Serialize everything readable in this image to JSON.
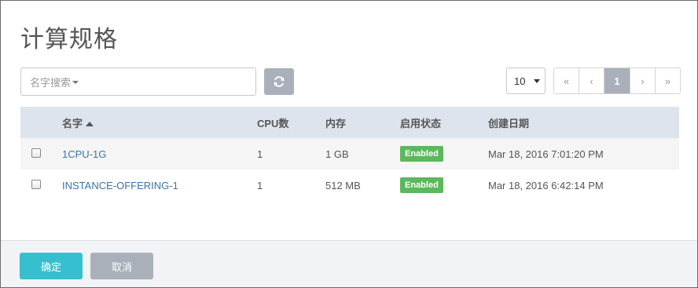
{
  "title": "计算规格",
  "search": {
    "placeholder": "名字搜索"
  },
  "toolbar": {
    "refresh_icon": "refresh-icon"
  },
  "page_size": {
    "value": "10"
  },
  "pagination": {
    "first": "«",
    "prev": "‹",
    "current": "1",
    "next": "›",
    "last": "»"
  },
  "table": {
    "headers": {
      "name": "名字",
      "cpu": "CPU数",
      "memory": "内存",
      "status": "启用状态",
      "created": "创建日期"
    },
    "rows": [
      {
        "name": "1CPU-1G",
        "cpu": "1",
        "memory": "1 GB",
        "status": "Enabled",
        "created": "Mar 18, 2016 7:01:20 PM"
      },
      {
        "name": "INSTANCE-OFFERING-1",
        "cpu": "1",
        "memory": "512 MB",
        "status": "Enabled",
        "created": "Mar 18, 2016 6:42:14 PM"
      }
    ]
  },
  "footer": {
    "ok_label": "确定",
    "cancel_label": "取消"
  },
  "colors": {
    "accent": "#36c0cf",
    "status_enabled": "#5cb85c",
    "link": "#3a75a8",
    "header_bg": "#dee4ee",
    "neutral_button": "#a9b0b9"
  }
}
